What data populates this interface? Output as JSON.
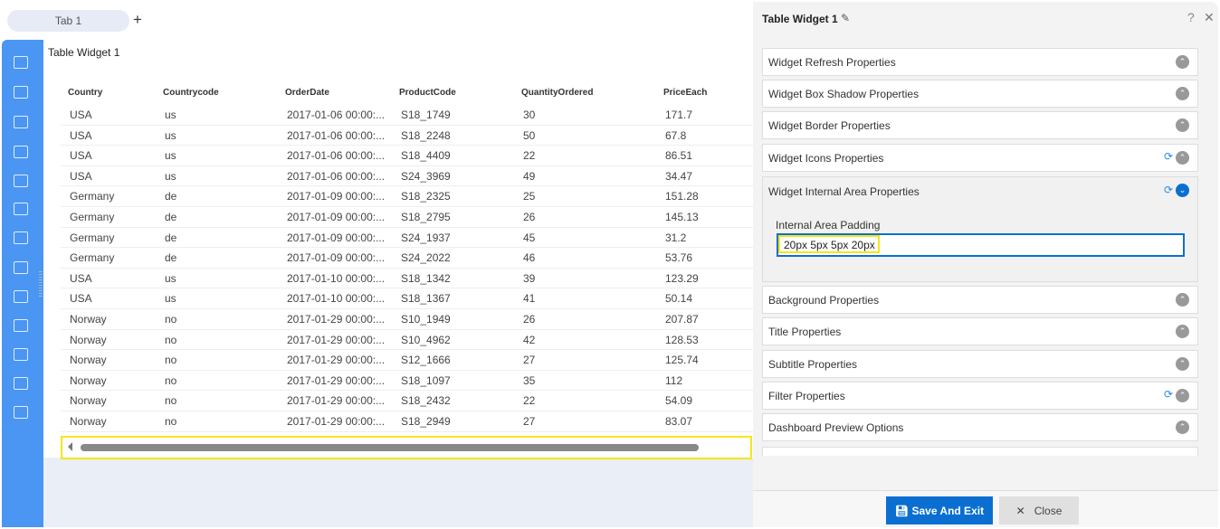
{
  "tabs": {
    "items": [
      {
        "label": "Tab 1"
      }
    ],
    "add_label": "+"
  },
  "sidebar": {
    "icons": [
      "sign-in-icon",
      "table-icon",
      "chart-icon",
      "map-icon",
      "report-icon",
      "card-icon",
      "code-braces-icon",
      "image-chart-icon",
      "pivot-icon",
      "excel-icon",
      "word-icon",
      "tree-icon",
      "analytics-icon"
    ]
  },
  "widget": {
    "title": "Table Widget 1"
  },
  "table": {
    "columns": [
      "Country",
      "Countrycode",
      "OrderDate",
      "ProductCode",
      "QuantityOrdered",
      "PriceEach"
    ],
    "rows": [
      [
        "USA",
        "us",
        "2017-01-06 00:00:...",
        "S18_1749",
        "30",
        "171.7"
      ],
      [
        "USA",
        "us",
        "2017-01-06 00:00:...",
        "S18_2248",
        "50",
        "67.8"
      ],
      [
        "USA",
        "us",
        "2017-01-06 00:00:...",
        "S18_4409",
        "22",
        "86.51"
      ],
      [
        "USA",
        "us",
        "2017-01-06 00:00:...",
        "S24_3969",
        "49",
        "34.47"
      ],
      [
        "Germany",
        "de",
        "2017-01-09 00:00:...",
        "S18_2325",
        "25",
        "151.28"
      ],
      [
        "Germany",
        "de",
        "2017-01-09 00:00:...",
        "S18_2795",
        "26",
        "145.13"
      ],
      [
        "Germany",
        "de",
        "2017-01-09 00:00:...",
        "S24_1937",
        "45",
        "31.2"
      ],
      [
        "Germany",
        "de",
        "2017-01-09 00:00:...",
        "S24_2022",
        "46",
        "53.76"
      ],
      [
        "USA",
        "us",
        "2017-01-10 00:00:...",
        "S18_1342",
        "39",
        "123.29"
      ],
      [
        "USA",
        "us",
        "2017-01-10 00:00:...",
        "S18_1367",
        "41",
        "50.14"
      ],
      [
        "Norway",
        "no",
        "2017-01-29 00:00:...",
        "S10_1949",
        "26",
        "207.87"
      ],
      [
        "Norway",
        "no",
        "2017-01-29 00:00:...",
        "S10_4962",
        "42",
        "128.53"
      ],
      [
        "Norway",
        "no",
        "2017-01-29 00:00:...",
        "S12_1666",
        "27",
        "125.74"
      ],
      [
        "Norway",
        "no",
        "2017-01-29 00:00:...",
        "S18_1097",
        "35",
        "112"
      ],
      [
        "Norway",
        "no",
        "2017-01-29 00:00:...",
        "S18_2432",
        "22",
        "54.09"
      ],
      [
        "Norway",
        "no",
        "2017-01-29 00:00:...",
        "S18_2949",
        "27",
        "83.07"
      ]
    ]
  },
  "panel": {
    "title": "Table Widget 1",
    "help": "?",
    "close": "✕",
    "sections": [
      {
        "label": "Widget Refresh Properties",
        "refresh": false
      },
      {
        "label": "Widget Box Shadow Properties",
        "refresh": false
      },
      {
        "label": "Widget Border Properties",
        "refresh": false
      },
      {
        "label": "Widget Icons Properties",
        "refresh": true
      }
    ],
    "expanded": {
      "label": "Widget Internal Area Properties",
      "field_label": "Internal Area Padding",
      "field_value": "20px 5px 5px 20px"
    },
    "sections_after": [
      {
        "label": "Background Properties",
        "refresh": false
      },
      {
        "label": "Title Properties",
        "refresh": false
      },
      {
        "label": "Subtitle Properties",
        "refresh": false
      },
      {
        "label": "Filter Properties",
        "refresh": true
      },
      {
        "label": "Dashboard Preview Options",
        "refresh": false
      }
    ],
    "save_label": "Save And Exit",
    "close_label": "Close"
  },
  "colors": {
    "sidebar": "#4b96f3",
    "primary": "#0a6fd1",
    "highlight": "#f5e61a"
  }
}
